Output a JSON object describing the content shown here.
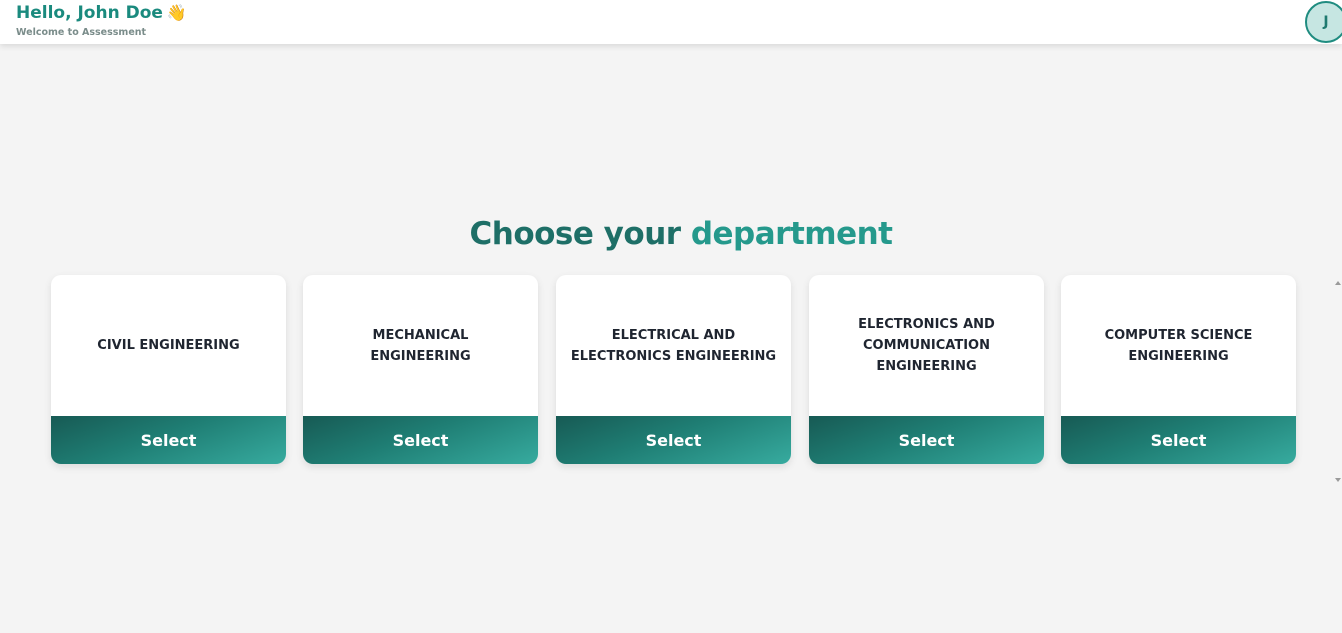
{
  "header": {
    "greeting": "Hello, John Doe",
    "wave_emoji": "👋",
    "subtitle": "Welcome to Assessment",
    "avatar_initial": "J"
  },
  "main": {
    "title_part1": "Choose your ",
    "title_part2": "department",
    "departments": [
      {
        "label": "CIVIL ENGINEERING",
        "button": "Select"
      },
      {
        "label": "MECHANICAL ENGINEERING",
        "button": "Select"
      },
      {
        "label": "ELECTRICAL AND ELECTRONICS ENGINEERING",
        "button": "Select"
      },
      {
        "label": "ELECTRONICS AND COMMUNICATION ENGINEERING",
        "button": "Select"
      },
      {
        "label": "COMPUTER SCIENCE ENGINEERING",
        "button": "Select"
      }
    ]
  },
  "colors": {
    "brand": "#1a8a7e",
    "button_dark": "#175a54",
    "button_light": "#37ab9f",
    "background": "#f4f4f4"
  }
}
